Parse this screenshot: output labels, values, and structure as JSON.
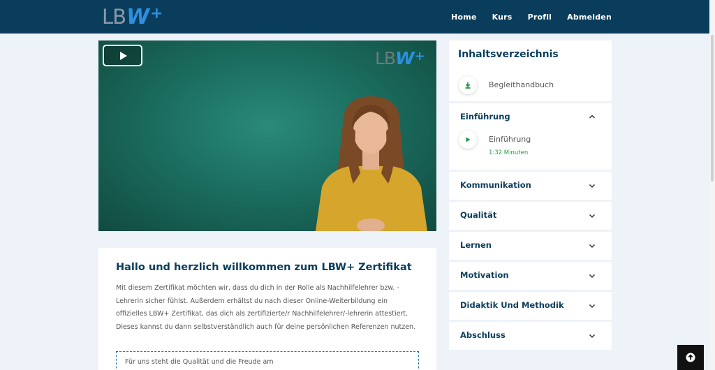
{
  "brand": {
    "logo_lb": "LB",
    "logo_w": "W",
    "logo_plus": "+"
  },
  "nav": {
    "items": [
      "Home",
      "Kurs",
      "Profil",
      "Abmelden"
    ]
  },
  "video": {
    "play_icon": "play-icon",
    "watermark_lb": "LB",
    "watermark_w": "W",
    "watermark_plus": "+"
  },
  "content": {
    "title": "Hallo und herzlich willkommen zum LBW+ Zertifikat",
    "paragraph": "Mit diesem Zertifikat möchten wir, dass du dich in der Rolle als Nachhilfelehrer bzw. -Lehrerin sicher fühlst. Außerdem erhältst du nach dieser Online-Weiterbildung ein offizielles LBW+ Zertifikat, das dich als zertifizierte/r Nachhilfelehrer/-lehrerin attestiert. Dieses kannst du dann selbstverständlich auch für deine persönlichen Referenzen nutzen.",
    "quote": "Für uns steht die Qualität und die Freude am"
  },
  "toc": {
    "title": "Inhaltsverzeichnis",
    "handbook_label": "Begleithandbuch",
    "open_section": {
      "label": "Einführung",
      "lesson_label": "Einführung",
      "lesson_duration": "1:32 Minuten"
    },
    "sections": [
      "Kommunikation",
      "Qualität",
      "Lernen",
      "Motivation",
      "Didaktik Und Methodik",
      "Abschluss"
    ]
  },
  "colors": {
    "header": "#0a3d5c",
    "accent_green": "#1e9e3e",
    "brand_blue": "#2d8fe0",
    "background": "#eef2f9"
  }
}
